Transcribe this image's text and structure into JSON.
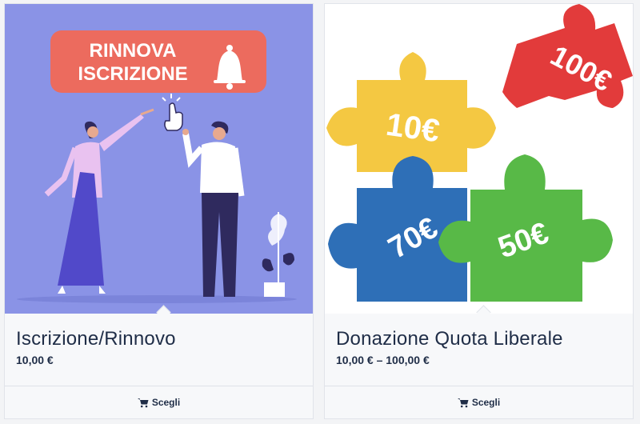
{
  "products": [
    {
      "image": {
        "kind": "illustration",
        "banner_line1": "RINNOVA",
        "banner_line2": "ISCRIZIONE",
        "icons": [
          "bell-icon",
          "pointer-hand-icon"
        ]
      },
      "title": "Iscrizione/Rinnovo",
      "price": "10,00 €",
      "button_label": "Scegli",
      "button_icon": "cart-icon"
    },
    {
      "image": {
        "kind": "puzzle-pieces",
        "pieces": [
          "10€",
          "100€",
          "70€",
          "50€"
        ],
        "colors": [
          "#f4c842",
          "#e23b3b",
          "#2e6fb7",
          "#58b947"
        ]
      },
      "title": "Donazione Quota Liberale",
      "price": "10,00 € – 100,00 €",
      "button_label": "Scegli",
      "button_icon": "cart-icon"
    }
  ],
  "colors": {
    "illustration_bg": "#8a93e6",
    "banner": "#ec6b5e",
    "text": "#1f2d47"
  }
}
